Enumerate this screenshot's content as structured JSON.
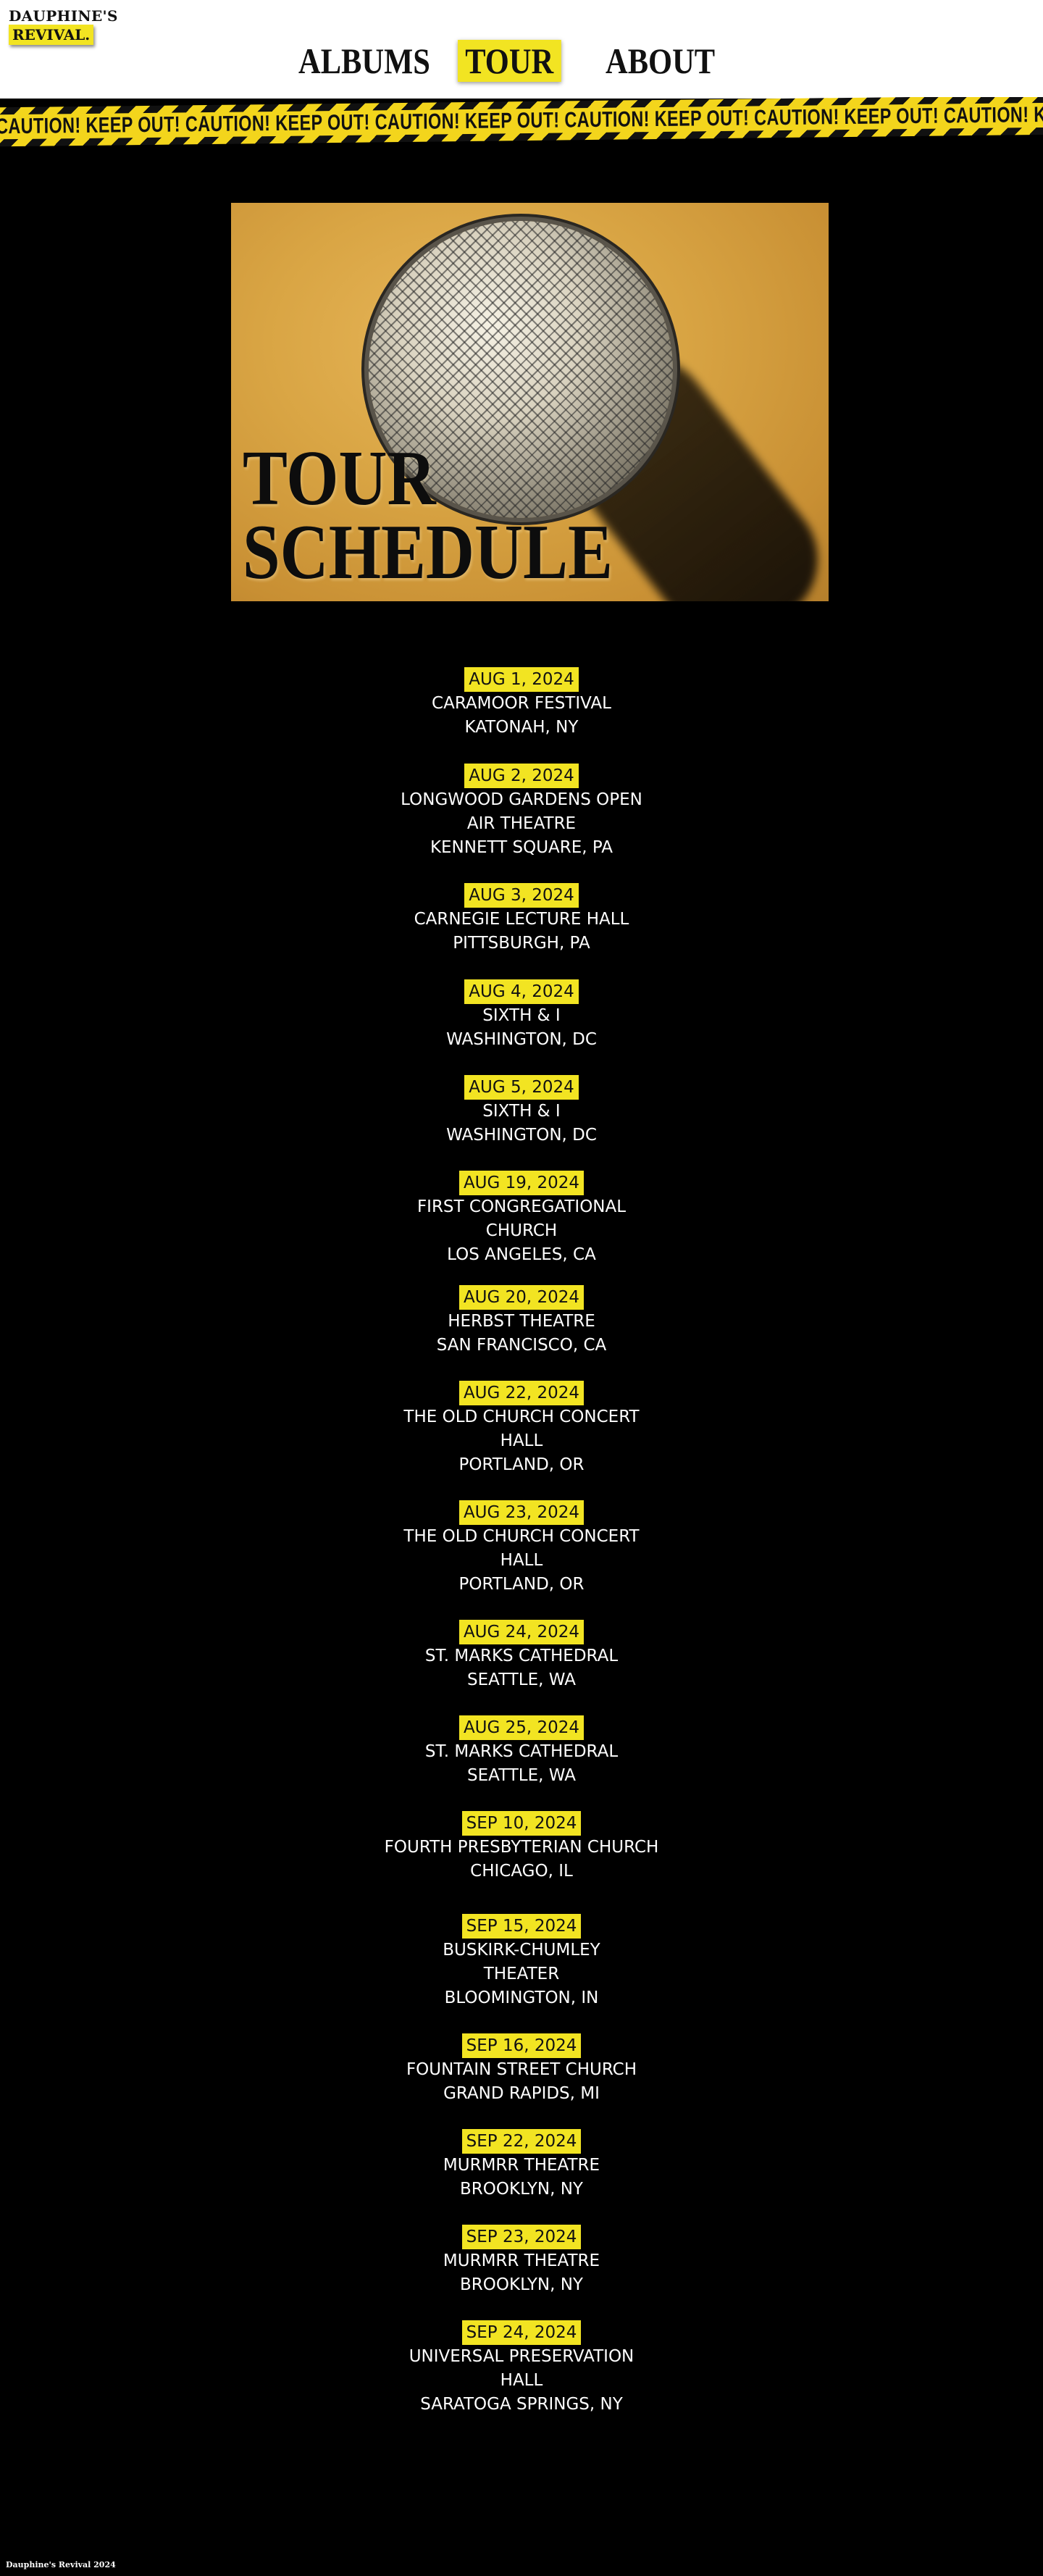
{
  "logo": {
    "line1": "DAUPHINE'S",
    "line2": "REVIVAL."
  },
  "nav": {
    "albums": "ALBUMS",
    "tour": "TOUR",
    "about": "ABOUT"
  },
  "tape": {
    "text": "CAUTION! KEEP OUT!  CAUTION! KEEP OUT!  CAUTION! KEEP OUT!  CAUTION! KEEP OUT!  CAUTION! KEEP OUT!  CAUTION! KEEP OUT!  CAUTION! KEEP OUT!"
  },
  "hero": {
    "title_line1": "TOUR",
    "title_line2": "SCHEDULE",
    "image": "microphone-photo"
  },
  "shows": [
    {
      "date": "AUG 1, 2024",
      "venue": [
        "CARAMOOR FESTIVAL"
      ],
      "city": "KATONAH, NY"
    },
    {
      "date": "AUG 2, 2024",
      "venue": [
        "LONGWOOD GARDENS OPEN",
        "AIR THEATRE"
      ],
      "city": "KENNETT SQUARE, PA"
    },
    {
      "date": "AUG 3, 2024",
      "venue": [
        "CARNEGIE LECTURE HALL"
      ],
      "city": "PITTSBURGH, PA"
    },
    {
      "date": "AUG 4, 2024",
      "venue": [
        "SIXTH & I"
      ],
      "city": "WASHINGTON, DC"
    },
    {
      "date": "AUG 5, 2024",
      "venue": [
        "SIXTH & I"
      ],
      "city": "WASHINGTON, DC"
    },
    {
      "date": "AUG 19, 2024",
      "venue": [
        "FIRST CONGREGATIONAL",
        "CHURCH"
      ],
      "city": "LOS ANGELES, CA"
    },
    {
      "date": "AUG 20, 2024",
      "venue": [
        "HERBST THEATRE"
      ],
      "city": "SAN FRANCISCO, CA"
    },
    {
      "date": "AUG 22, 2024",
      "venue": [
        "THE OLD CHURCH CONCERT",
        "HALL"
      ],
      "city": "PORTLAND, OR"
    },
    {
      "date": "AUG 23, 2024",
      "venue": [
        "THE OLD CHURCH CONCERT",
        "HALL"
      ],
      "city": "PORTLAND, OR"
    },
    {
      "date": "AUG 24, 2024",
      "venue": [
        "ST. MARKS CATHEDRAL"
      ],
      "city": "SEATTLE, WA"
    },
    {
      "date": "AUG 25, 2024",
      "venue": [
        "ST. MARKS CATHEDRAL"
      ],
      "city": "SEATTLE, WA"
    },
    {
      "date": "SEP 10, 2024",
      "venue": [
        "FOURTH PRESBYTERIAN CHURCH"
      ],
      "city": "CHICAGO, IL"
    },
    {
      "date": "SEP 15, 2024",
      "venue": [
        "BUSKIRK-CHUMLEY",
        "THEATER"
      ],
      "city": "BLOOMINGTON, IN"
    },
    {
      "date": "SEP 16, 2024",
      "venue": [
        "FOUNTAIN STREET CHURCH"
      ],
      "city": "GRAND RAPIDS, MI"
    },
    {
      "date": "SEP 22, 2024",
      "venue": [
        "MURMRR THEATRE"
      ],
      "city": "BROOKLYN, NY"
    },
    {
      "date": "SEP 23, 2024",
      "venue": [
        "MURMRR THEATRE"
      ],
      "city": "BROOKLYN, NY"
    },
    {
      "date": "SEP 24, 2024",
      "venue": [
        "UNIVERSAL PRESERVATION",
        "HALL"
      ],
      "city": "SARATOGA SPRINGS, NY"
    }
  ],
  "footer": {
    "text": "Dauphine's Revival 2024"
  },
  "colors": {
    "accent": "#f2e422",
    "background": "#000000",
    "header_bg": "#ffffff"
  }
}
